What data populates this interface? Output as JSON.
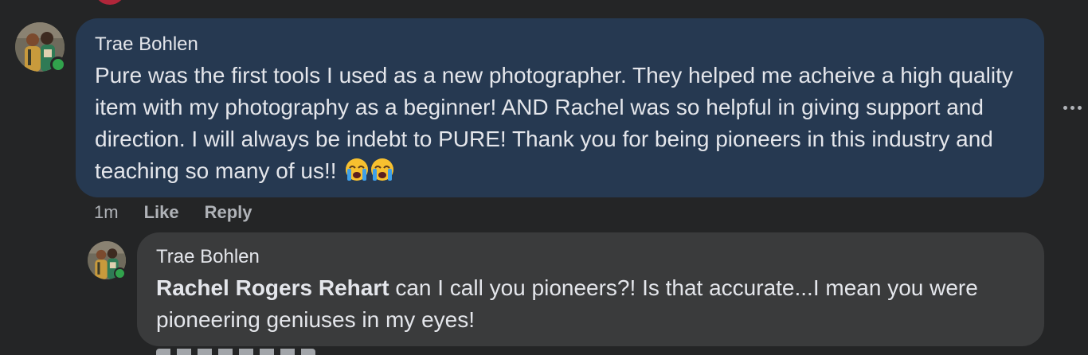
{
  "colors": {
    "page_bg": "#242526",
    "main_bubble_bg": "#263951",
    "reply_bubble_bg": "#3a3b3c",
    "text_primary": "#e4e6eb",
    "text_secondary": "#b0b3b8",
    "online": "#31a24c"
  },
  "comment": {
    "author": "Trae Bohlen",
    "text": "Pure was the first tools I used as a new photographer. They helped me acheive a high quality item with my photography as a beginner! AND Rachel was so helpful in giving support and direction. I will always be indebt to PURE! Thank you for being pioneers in this industry and teaching so many of us!!",
    "emoji": [
      "loudly-crying-face",
      "loudly-crying-face"
    ],
    "time": "1m",
    "like_label": "Like",
    "reply_label": "Reply",
    "more_icon": "more-horizontal-icon"
  },
  "reply": {
    "author": "Trae Bohlen",
    "mention": "Rachel Rogers Rehart",
    "text": " can I call you pioneers?! Is that accurate...I mean you were pioneering geniuses in my eyes!"
  }
}
